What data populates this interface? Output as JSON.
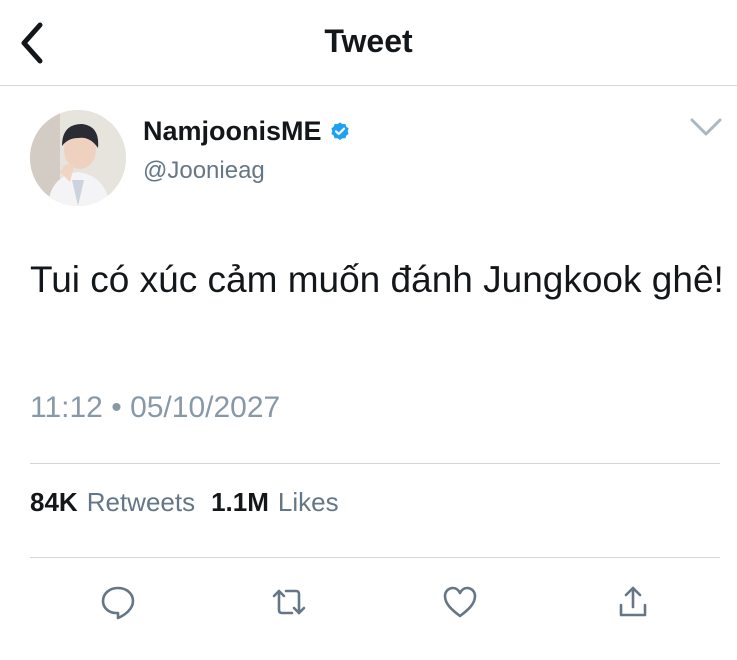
{
  "header": {
    "title": "Tweet",
    "back_icon": "chevron-left-icon"
  },
  "author": {
    "display_name": "NamjoonisME",
    "handle": "@Joonieag",
    "verified": true,
    "verified_color": "#1da1f2"
  },
  "tweet": {
    "text": "Tui có xúc cảm muốn đánh Jungkook ghê!",
    "time": "11:12",
    "separator": "•",
    "date": "05/10/2027"
  },
  "stats": {
    "retweets_count": "84K",
    "retweets_label": "Retweets",
    "likes_count": "1.1M",
    "likes_label": "Likes"
  },
  "actions": [
    "reply-icon",
    "retweet-icon",
    "like-icon",
    "share-icon"
  ],
  "colors": {
    "text": "#14171a",
    "secondary": "#657786",
    "muted": "#8899a6",
    "icon": "#657786",
    "divider": "#d6d6d6"
  }
}
